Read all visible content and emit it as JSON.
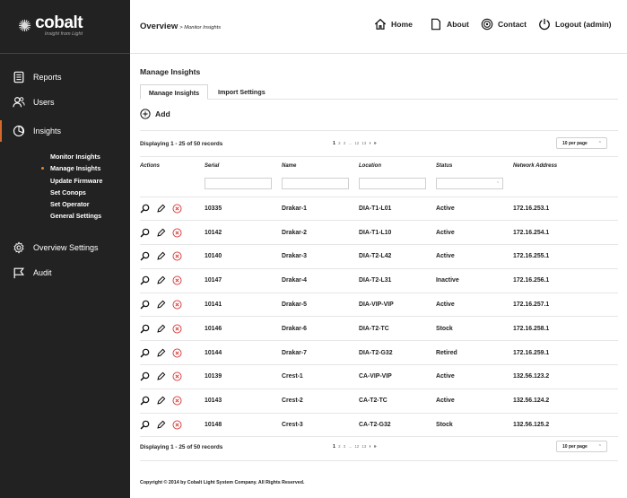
{
  "brand": {
    "name": "cobalt",
    "tagline": "Insight from Light"
  },
  "sidebar": {
    "items": [
      {
        "label": "Reports",
        "icon": "report-icon"
      },
      {
        "label": "Users",
        "icon": "users-icon"
      },
      {
        "label": "Insights",
        "icon": "insights-icon"
      },
      {
        "label": "Overview Settings",
        "icon": "settings-icon"
      },
      {
        "label": "Audit",
        "icon": "flag-icon"
      }
    ],
    "submenu": [
      "Monitor Insights",
      "Manage Insights",
      "Update Firmware",
      "Set Conops",
      "Set Operator",
      "General Settings"
    ],
    "active_submenu": "Manage Insights"
  },
  "header": {
    "title": "Overview",
    "breadcrumb": "> Monitor Insights",
    "nav": {
      "home": "Home",
      "about": "About",
      "contact": "Contact",
      "logout": "Logout (admin)"
    }
  },
  "main": {
    "section_title": "Manage Insights",
    "tabs": [
      "Manage Insights",
      "Import Settings"
    ],
    "add_label": "Add",
    "records_label": "Displaying 1 - 25 of 50 records",
    "pagination": {
      "current": "1",
      "pages": "2 3 ... 12 13",
      "next": "› »"
    },
    "per_page": "10 per page",
    "columns": [
      "Actions",
      "Serial",
      "Name",
      "Location",
      "Status",
      "Network Address"
    ],
    "rows": [
      {
        "serial": "10335",
        "name": "Drakar-1",
        "location": "DIA-T1-L01",
        "status": "Active",
        "network": "172.16.253.1"
      },
      {
        "serial": "10142",
        "name": "Drakar-2",
        "location": "DIA-T1-L10",
        "status": "Active",
        "network": "172.16.254.1"
      },
      {
        "serial": "10140",
        "name": "Drakar-3",
        "location": "DIA-T2-L42",
        "status": "Active",
        "network": "172.16.255.1"
      },
      {
        "serial": "10147",
        "name": "Drakar-4",
        "location": "DIA-T2-L31",
        "status": "Inactive",
        "network": "172.16.256.1"
      },
      {
        "serial": "10141",
        "name": "Drakar-5",
        "location": "DIA-VIP-VIP",
        "status": "Active",
        "network": "172.16.257.1"
      },
      {
        "serial": "10146",
        "name": "Drakar-6",
        "location": "DIA-T2-TC",
        "status": "Stock",
        "network": "172.16.258.1"
      },
      {
        "serial": "10144",
        "name": "Drakar-7",
        "location": "DIA-T2-G32",
        "status": "Retired",
        "network": "172.16.259.1"
      },
      {
        "serial": "10139",
        "name": "Crest-1",
        "location": "CA-VIP-VIP",
        "status": "Active",
        "network": "132.56.123.2"
      },
      {
        "serial": "10143",
        "name": "Crest-2",
        "location": "CA-T2-TC",
        "status": "Active",
        "network": "132.56.124.2"
      },
      {
        "serial": "10148",
        "name": "Crest-3",
        "location": "CA-T2-G32",
        "status": "Stock",
        "network": "132.56.125.2"
      }
    ]
  },
  "footer": {
    "copyright": "Copyright © 2014 by Cobalt Light System Company. All Rights Reserved."
  },
  "colors": {
    "sidebar_bg": "#222222",
    "accent": "#e3832f",
    "delete": "#d62f2f"
  }
}
